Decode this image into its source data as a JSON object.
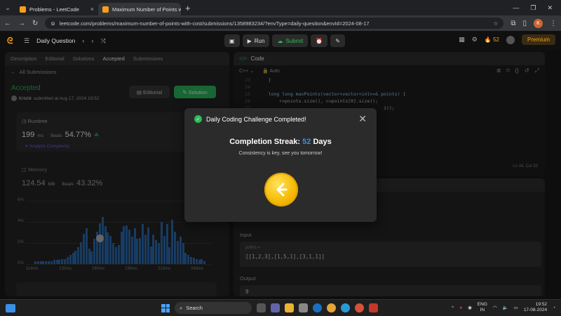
{
  "browser": {
    "tabs": [
      {
        "title": "Problems - LeetCode",
        "active": false
      },
      {
        "title": "Maximum Number of Points wi",
        "active": true
      }
    ],
    "url": "leetcode.com/problems/maximum-number-of-points-with-cost/submissions/1358983234/?envType=daily-question&envId=2024-08-17",
    "profile_initial": "K"
  },
  "nav": {
    "title": "Daily Question",
    "run_label": "Run",
    "submit_label": "Submit",
    "streak_count": "52",
    "premium_label": "Premium"
  },
  "left": {
    "tabs": [
      "Description",
      "Editorial",
      "Solutions",
      "Accepted",
      "Submissions"
    ],
    "all_submissions": "All Submissions",
    "status": "Accepted",
    "submitted_user": "Krishii",
    "submitted_text": "submitted at Aug 17, 2024 19:52",
    "editorial_btn": "Editorial",
    "solution_btn": "Solution",
    "runtime_label": "Runtime",
    "runtime_value": "199",
    "runtime_unit": "ms",
    "beats_label": "Beats",
    "runtime_beats": "54.77%",
    "complexity_label": "Analyze Complexity",
    "memory_label": "Memory",
    "memory_value": "124.54",
    "memory_unit": "MB",
    "memory_beats": "43.32%"
  },
  "chart_data": {
    "type": "bar",
    "y_ticks": [
      "6%",
      "4%",
      "2%",
      "0%"
    ],
    "x_ticks": [
      "114ms",
      "130ms",
      "160ms",
      "190ms",
      "210ms",
      "245ms"
    ],
    "ylim": [
      0,
      6
    ],
    "values": [
      0.3,
      0.3,
      0.3,
      0.3,
      0.3,
      0.3,
      0.3,
      0.4,
      0.4,
      0.4,
      0.5,
      0.5,
      0.7,
      0.9,
      1.1,
      1.3,
      1.6,
      2.1,
      2.9,
      3.4,
      1.5,
      1.2,
      2.4,
      3.1,
      3.9,
      4.5,
      3.6,
      3.0,
      2.7,
      2.0,
      1.6,
      1.8,
      3.1,
      3.6,
      3.7,
      3.3,
      2.6,
      3.4,
      2.4,
      2.5,
      3.8,
      2.8,
      3.5,
      1.7,
      2.8,
      2.3,
      2.0,
      4.0,
      2.7,
      3.8,
      1.6,
      4.2,
      3.1,
      2.2,
      2.6,
      2.0,
      1.1,
      0.9,
      0.7,
      0.6,
      0.5,
      0.4,
      0.5,
      0.3
    ],
    "color": "#2d6db5"
  },
  "editor": {
    "header": "Code",
    "lang": "C++",
    "mode": "Auto",
    "lines": [
      {
        "n": "23",
        "t": "    }"
      },
      {
        "n": "24",
        "t": ""
      },
      {
        "n": "25",
        "t": "    long long maxPoints(vector<vector<int>>& points) {"
      },
      {
        "n": "26",
        "t": "        r=points.size(), c=points[0].size();"
      },
      {
        "n": "27",
        "t": "                                              1));"
      },
      {
        "n": "28",
        "t": ""
      },
      {
        "n": "29",
        "t": ""
      },
      {
        "n": "30",
        "t": ""
      },
      {
        "n": "31",
        "t": ""
      }
    ],
    "position": "Ln 34, Col 20"
  },
  "testcase": {
    "input_label": "Input",
    "var_name": "points =",
    "var_value": "[[1,2,3],[1,5,1],[3,1,1]]",
    "output_label": "Output",
    "output_value": "9"
  },
  "modal": {
    "title": "Daily Coding Challenge Completed!",
    "streak_prefix": "Completion Streak:",
    "streak_number": "52",
    "streak_suffix": "Days",
    "message": "Consistency is key, see you tomorrow!"
  },
  "taskbar": {
    "search_placeholder": "Search",
    "lang_top": "ENG",
    "lang_bottom": "IN",
    "time": "19:52",
    "date": "17-08-2024"
  },
  "colors": {
    "accent_green": "#2cbb5d",
    "brand_orange": "#f89f1b",
    "streak_blue": "#3d8ee6"
  }
}
